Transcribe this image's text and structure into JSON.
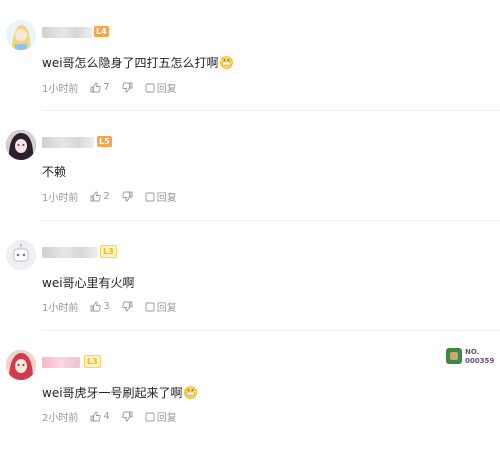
{
  "comments": [
    {
      "text": "wei哥怎么隐身了四打五怎么打啊",
      "level": "L4",
      "time": "1小时前",
      "likes": "7",
      "reply_label": "回复",
      "avatar": "anime-girl-avatar",
      "has_emoji": true
    },
    {
      "text": "不赖",
      "level": "L5",
      "time": "1小时前",
      "likes": "2",
      "reply_label": "回复",
      "avatar": "dark-hair-girl-avatar",
      "has_emoji": false
    },
    {
      "text": "wei哥心里有火啊",
      "level": "L3",
      "time": "1小时前",
      "likes": "3",
      "reply_label": "回复",
      "avatar": "robot-avatar",
      "has_emoji": false
    },
    {
      "text": "wei哥虎牙一号刷起来了啊",
      "level": "L3",
      "time": "2小时前",
      "likes": "4",
      "reply_label": "回复",
      "avatar": "pink-hair-girl-avatar",
      "has_emoji": true
    }
  ],
  "fan_badge": {
    "label": "NO.",
    "number": "000359"
  },
  "colors": {
    "level_orange": "#f5a54a",
    "meta_gray": "#999999"
  }
}
